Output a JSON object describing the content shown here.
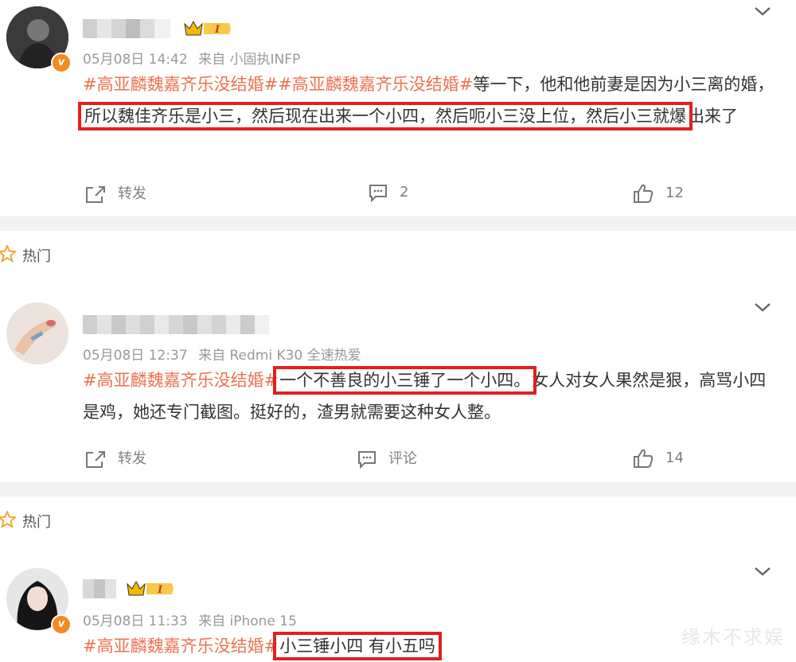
{
  "hot_label": "热门",
  "watermark": "缘木不求娱",
  "posts": [
    {
      "time": "05月08日 14:42",
      "source": "来自 小固执INFP",
      "topics": "#高亚麟魏嘉齐乐没结婚##高亚麟魏嘉齐乐没结婚#",
      "text_before": "等一下，他和他前妻是因为小三离的婚，",
      "highlight": "所以魏佳齐乐是小三，然后现在出来一个小四，然后呃小三没上位，然后小三就爆",
      "text_after": "出来了",
      "repost_label": "转发",
      "comment_label": "2",
      "like_count": "12",
      "badge_level": "I"
    },
    {
      "time": "05月08日 12:37",
      "source": "来自 Redmi K30 全速热爱",
      "topics": "#高亚麟魏嘉齐乐没结婚#",
      "highlight": "一个不善良的小三锤了一个小四。",
      "text_after": "女人对女人果然是狠，高骂小四是鸡，她还专门截图。挺好的，渣男就需要这种女人整。",
      "repost_label": "转发",
      "comment_label": "评论",
      "like_count": "14"
    },
    {
      "time": "05月08日 11:33",
      "source": "来自 iPhone 15",
      "topics": "#高亚麟魏嘉齐乐没结婚#",
      "highlight": "小三锤小四 有小五吗",
      "badge_level": "I"
    }
  ],
  "colors": {
    "topic": "#eb7350",
    "highlight_box": "#e02020",
    "verified": "#f28b21",
    "meta": "#999999"
  }
}
